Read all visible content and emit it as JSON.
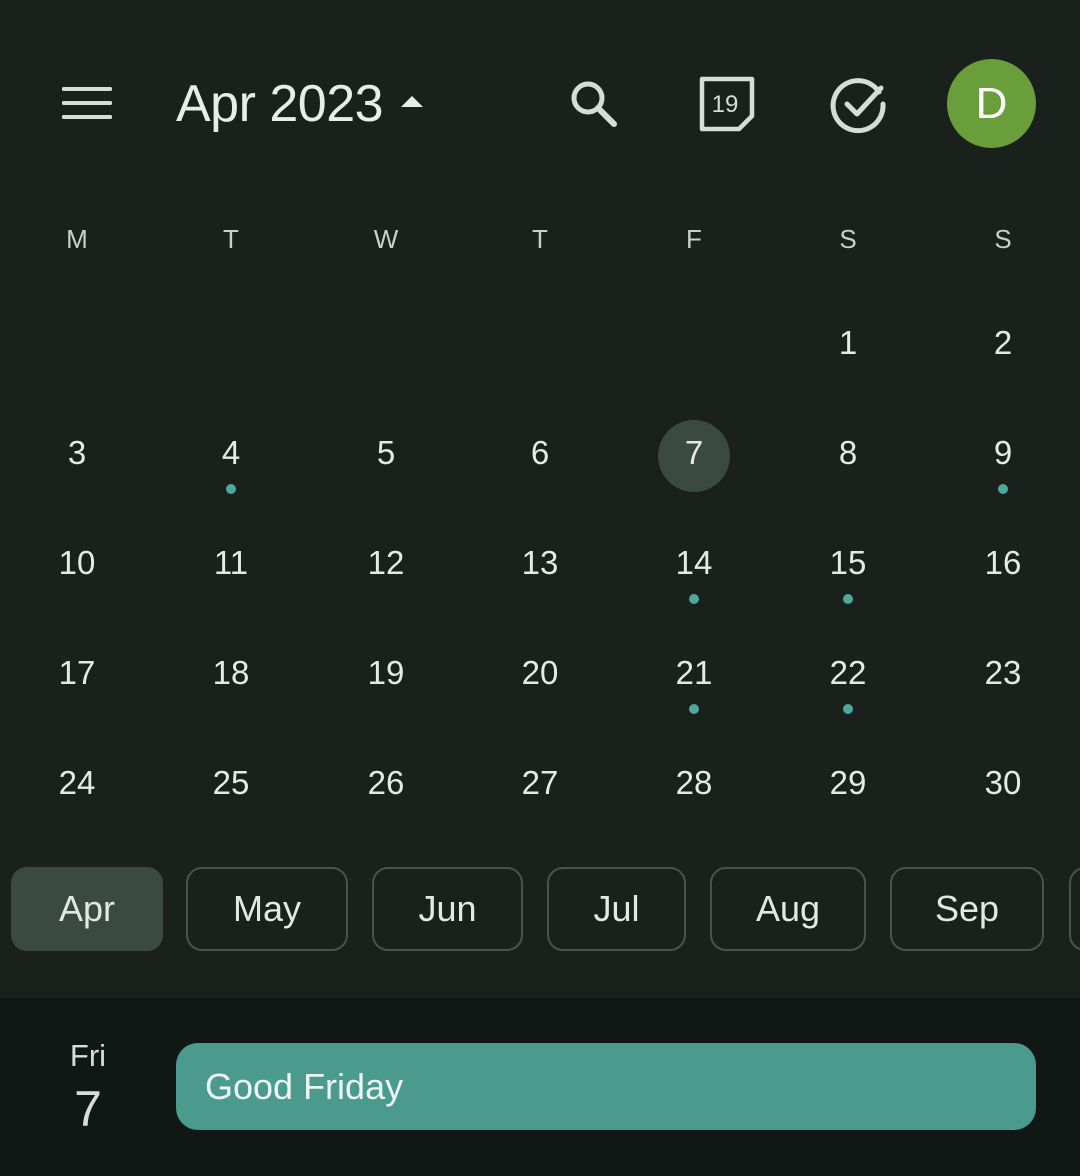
{
  "colors": {
    "background": "#1a211d",
    "agenda_background": "#111714",
    "accent_teal": "#4a9a8e",
    "event_dot": "#4fa89c",
    "selected_bg": "#3a4a40",
    "avatar_bg": "#6a9e3a"
  },
  "header": {
    "title": "Apr 2023",
    "menu_icon": "hamburger-menu-icon",
    "search_icon": "search-icon",
    "today_icon_number": "19",
    "tasks_icon": "check-circle-icon",
    "avatar_letter": "D"
  },
  "weekdays": [
    "M",
    "T",
    "W",
    "T",
    "F",
    "S",
    "S"
  ],
  "calendar": {
    "selected_day": "7",
    "weeks": [
      [
        {
          "d": ""
        },
        {
          "d": ""
        },
        {
          "d": ""
        },
        {
          "d": ""
        },
        {
          "d": ""
        },
        {
          "d": "1"
        },
        {
          "d": "2"
        }
      ],
      [
        {
          "d": "3"
        },
        {
          "d": "4",
          "dot": true
        },
        {
          "d": "5"
        },
        {
          "d": "6"
        },
        {
          "d": "7",
          "selected": true
        },
        {
          "d": "8"
        },
        {
          "d": "9",
          "dot": true
        }
      ],
      [
        {
          "d": "10"
        },
        {
          "d": "11"
        },
        {
          "d": "12"
        },
        {
          "d": "13"
        },
        {
          "d": "14",
          "dot": true
        },
        {
          "d": "15",
          "dot": true
        },
        {
          "d": "16"
        }
      ],
      [
        {
          "d": "17"
        },
        {
          "d": "18"
        },
        {
          "d": "19"
        },
        {
          "d": "20"
        },
        {
          "d": "21",
          "dot": true
        },
        {
          "d": "22",
          "dot": true
        },
        {
          "d": "23"
        }
      ],
      [
        {
          "d": "24"
        },
        {
          "d": "25"
        },
        {
          "d": "26"
        },
        {
          "d": "27"
        },
        {
          "d": "28"
        },
        {
          "d": "29"
        },
        {
          "d": "30"
        }
      ]
    ]
  },
  "months": [
    {
      "label": "Apr",
      "active": true
    },
    {
      "label": "May"
    },
    {
      "label": "Jun"
    },
    {
      "label": "Jul"
    },
    {
      "label": "Aug"
    },
    {
      "label": "Sep"
    },
    {
      "label": ""
    }
  ],
  "agenda": {
    "day_of_week": "Fri",
    "day_number": "7",
    "event_title": "Good Friday"
  }
}
